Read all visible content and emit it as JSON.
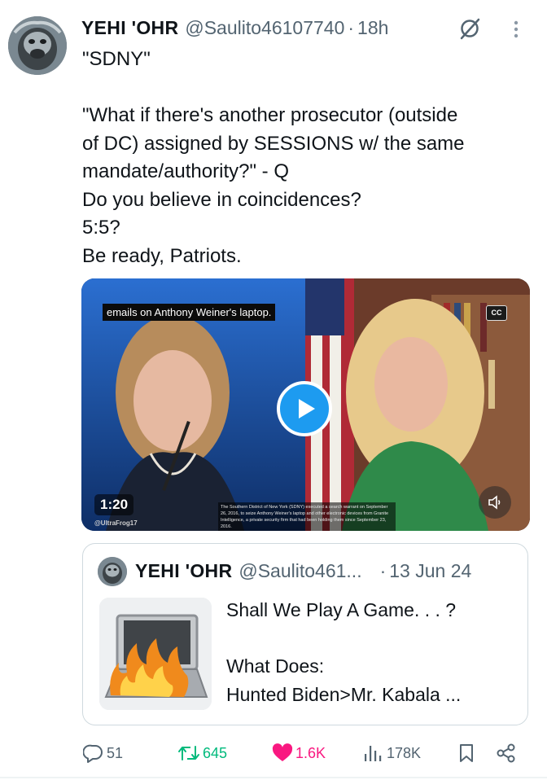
{
  "post": {
    "author_name": "YEHI 'OHR",
    "handle": "@Saulito46107740",
    "separator": "·",
    "time": "18h",
    "text_lines": [
      "\"SDNY\"",
      "",
      "\"What if there's another prosecutor (outside",
      "of DC) assigned by SESSIONS w/ the same",
      "mandate/authority?\" - Q",
      "Do you believe in coincidences?",
      "5:5?",
      "Be ready, Patriots."
    ],
    "icons": [
      "avatar",
      "grok-icon",
      "more-icon"
    ]
  },
  "media": {
    "caption_top": "emails on Anthony Weiner's laptop.",
    "cc_label": "CC",
    "duration": "1:20",
    "watermark": "@UltraFrog17",
    "subtitle": "The Southern District of New York (SDNY) executed a search warrant on September 26, 2016, to seize Anthony Weiner's laptop and other electronic devices from Granite Intelligence, a private security firm that had been holding them since September 23, 2016.",
    "colors": {
      "accent": "#1d9bf0"
    }
  },
  "quote": {
    "author_name": "YEHI 'OHR",
    "handle": "@Saulito461...",
    "separator": "·",
    "date": "13 Jun 24",
    "text_lines": [
      "Shall We Play A Game. . . ?",
      "",
      "What Does:",
      "Hunted Biden>Mr. Kabala ..."
    ]
  },
  "actions": {
    "replies": "51",
    "reposts": "645",
    "likes": "1.6K",
    "views": "178K",
    "icons": [
      "reply-icon",
      "repost-icon",
      "like-icon",
      "views-icon",
      "bookmark-icon",
      "share-icon"
    ],
    "colors": {
      "repost": "#00ba7c",
      "like": "#f91880",
      "muted": "#536471"
    }
  }
}
